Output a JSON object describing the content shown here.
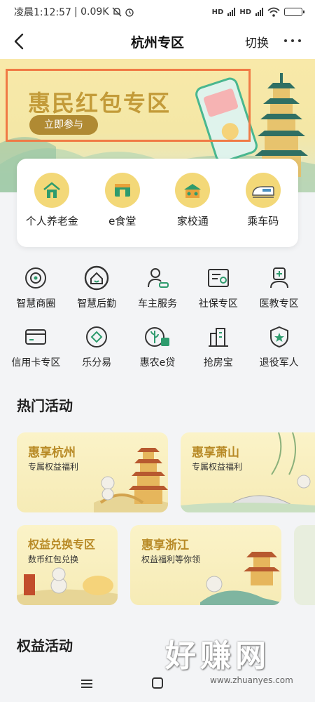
{
  "status_bar": {
    "time": "凌晨1:12:57",
    "speed": "| 0.09K",
    "net1": "HD",
    "net2": "HD",
    "battery_level": 0.9
  },
  "nav": {
    "title": "杭州专区",
    "switch": "切换",
    "icons": [
      "back-arrow-icon",
      "more-dots-icon"
    ]
  },
  "banner": {
    "title": "惠民红包专区",
    "button": "立即参与"
  },
  "features": [
    {
      "label": "个人养老金",
      "icon": "pension-house-icon"
    },
    {
      "label": "e食堂",
      "icon": "canteen-icon"
    },
    {
      "label": "家校通",
      "icon": "school-icon"
    },
    {
      "label": "乘车码",
      "icon": "train-icon"
    }
  ],
  "grid": [
    [
      {
        "label": "智慧商圈",
        "icon": "smart-mall-icon"
      },
      {
        "label": "智慧后勤",
        "icon": "smart-logistics-icon"
      },
      {
        "label": "车主服务",
        "icon": "car-owner-icon"
      },
      {
        "label": "社保专区",
        "icon": "social-security-icon"
      },
      {
        "label": "医教专区",
        "icon": "medical-education-icon"
      }
    ],
    [
      {
        "label": "信用卡专区",
        "icon": "credit-card-icon"
      },
      {
        "label": "乐分易",
        "icon": "installment-icon"
      },
      {
        "label": "惠农e贷",
        "icon": "agri-loan-icon"
      },
      {
        "label": "抢房宝",
        "icon": "housing-icon"
      },
      {
        "label": "退役军人",
        "icon": "veteran-shield-icon"
      }
    ]
  ],
  "hot_section": {
    "title": "热门活动"
  },
  "activities_row1": [
    {
      "title": "惠享杭州",
      "subtitle": "专属权益福利"
    },
    {
      "title": "惠享萧山",
      "subtitle": "专属权益福利"
    }
  ],
  "activities_row2": [
    {
      "title": "权益兑换专区",
      "subtitle": "数币红包兑换"
    },
    {
      "title": "惠享浙江",
      "subtitle": "权益福利等你领"
    }
  ],
  "rights_section": {
    "title": "权益活动"
  },
  "watermark": {
    "text": "好赚网",
    "url": "www.zhuanyes.com"
  },
  "colors": {
    "gold": "#c39b39",
    "green": "#2e9b6d",
    "highlight": "#f07a45"
  }
}
